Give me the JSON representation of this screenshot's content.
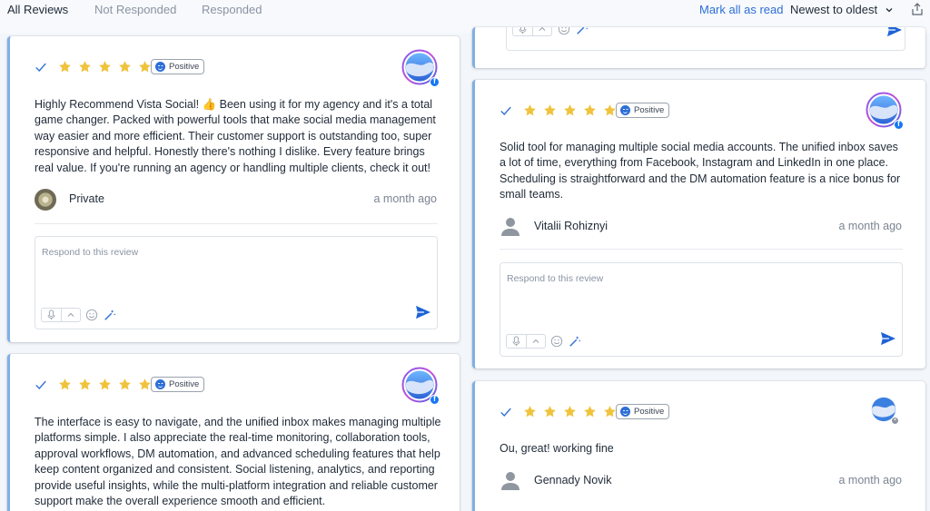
{
  "tabs": [
    {
      "label": "All Reviews",
      "active": true
    },
    {
      "label": "Not Responded",
      "active": false
    },
    {
      "label": "Responded",
      "active": false
    }
  ],
  "toolbar": {
    "mark_all_read": "Mark all as read",
    "sort_label": "Newest to oldest",
    "share_icon": "share-icon"
  },
  "reply_placeholder": "Respond to this review",
  "colors": {
    "accent": "#2d6fd6",
    "star": "#f0c33c",
    "card_border": "#7fb0e3"
  },
  "reviews": [
    {
      "rating": 5,
      "sentiment": "Positive",
      "text": "Highly Recommend Vista Social! 👍 Been using it for my agency and it's a total game changer. Packed with powerful tools that make social media management way easier and more efficient. Their customer support is outstanding too, super responsive and helpful. Honestly there's nothing I dislike. Every feature brings real value. If you're running an agency or handling multiple clients, check it out!",
      "author": "Private",
      "time": "a month ago",
      "source": "facebook"
    },
    {
      "rating": 5,
      "sentiment": "Positive",
      "text": "Solid tool for managing multiple social media accounts. The unified inbox saves a lot of time, everything from Facebook, Instagram and LinkedIn in one place. Scheduling is straightforward and the DM automation feature is a nice bonus for small teams.",
      "author": "Vitalii Rohiznyi",
      "time": "a month ago",
      "source": "facebook"
    },
    {
      "rating": 5,
      "sentiment": "Positive",
      "text": "The interface is easy to navigate, and the unified inbox makes managing multiple platforms simple. I also appreciate the real-time monitoring, collaboration tools, approval workflows, DM automation, and advanced scheduling features that help keep content organized and consistent. Social listening, analytics, and reporting provide useful insights, while the multi-platform integration and reliable customer support make the overall experience smooth and efficient.",
      "author": "",
      "time": "",
      "source": "facebook"
    },
    {
      "rating": 5,
      "sentiment": "Positive",
      "text": "Ou, great! working fine",
      "author": "Gennady Novik",
      "time": "a month ago",
      "source": "other"
    }
  ]
}
